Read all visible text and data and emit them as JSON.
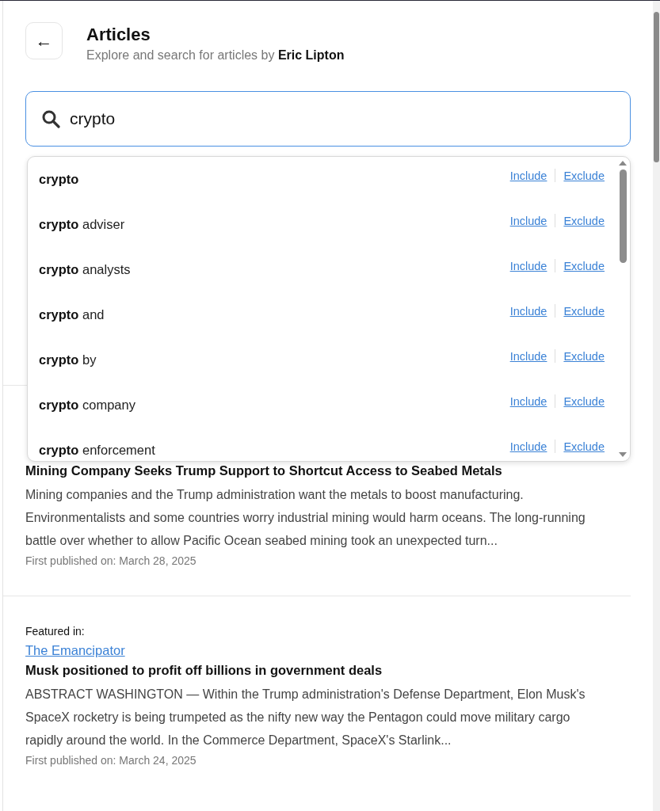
{
  "header": {
    "back_button": "←",
    "title": "Articles",
    "subtitle": "Explore and search for articles by **Eric Lipton**"
  },
  "search": {
    "value": "crypto"
  },
  "suggestions": [
    {
      "label": "**crypto**",
      "include": "Include",
      "exclude": "Exclude"
    },
    {
      "label": "**crypto** adviser",
      "include": "Include",
      "exclude": "Exclude"
    },
    {
      "label": "**crypto** analysts",
      "include": "Include",
      "exclude": "Exclude"
    },
    {
      "label": "**crypto** and",
      "include": "Include",
      "exclude": "Exclude"
    },
    {
      "label": "**crypto** by",
      "include": "Include",
      "exclude": "Exclude"
    },
    {
      "label": "**crypto** company",
      "include": "Include",
      "exclude": "Exclude"
    },
    {
      "label": "**crypto** enforcement",
      "include": "Include",
      "exclude": "Exclude"
    }
  ],
  "articles": [
    {
      "title": "Mining Company Seeks Trump Support to Shortcut Access to Seabed Metals",
      "summary": "Mining companies and the Trump administration want the metals to boost manufacturing. Environmentalists and some countries worry industrial mining would harm oceans. The long-running battle over whether to allow Pacific Ocean seabed mining took an unexpected turn...",
      "date": "First published on: March 28, 2025"
    },
    {
      "featured_label": "Featured in:",
      "featured_link": "The Emancipator",
      "title": "Musk positioned to profit off billions in government deals",
      "summary": "ABSTRACT WASHINGTON — Within the Trump administration's Defense Department, Elon Musk's SpaceX rocketry is being trumpeted as the nifty new way the Pentagon could move military cargo rapidly around the world. In the Commerce Department, SpaceX's Starlink...",
      "date": "First published on: March 24, 2025"
    }
  ]
}
